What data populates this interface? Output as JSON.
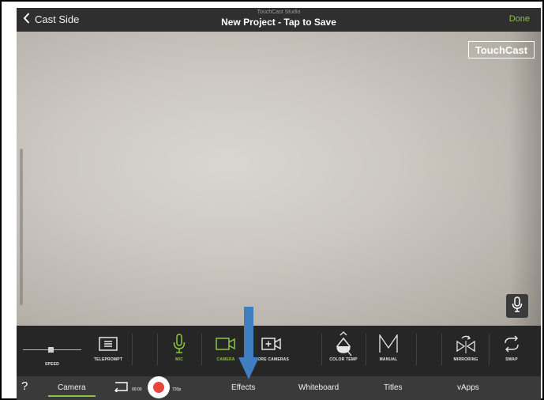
{
  "header": {
    "back_label": "Cast Side",
    "subtitle": "TouchCast Studio",
    "title": "New Project - Tap to Save",
    "done_label": "Done"
  },
  "preview": {
    "watermark": "TouchCast"
  },
  "toolbar": {
    "speed": "SPEED",
    "teleprompt": "TELEPROMPT",
    "mic": "MIC",
    "camera": "CAMERA",
    "more_cameras": "MORE CAMERAS",
    "color_temp": "COLOR TEMP",
    "manual": "MANUAL",
    "mirroring": "MIRRORING",
    "swap": "SWAP"
  },
  "tabbar": {
    "help": "?",
    "camera": "Camera",
    "time": "00:00",
    "resolution": "720p",
    "effects": "Effects",
    "whiteboard": "Whiteboard",
    "titles": "Titles",
    "vapps": "vApps"
  },
  "colors": {
    "accent_green": "#8cc63f",
    "record_red": "#e8453c",
    "arrow_blue": "#3f7fc1"
  }
}
